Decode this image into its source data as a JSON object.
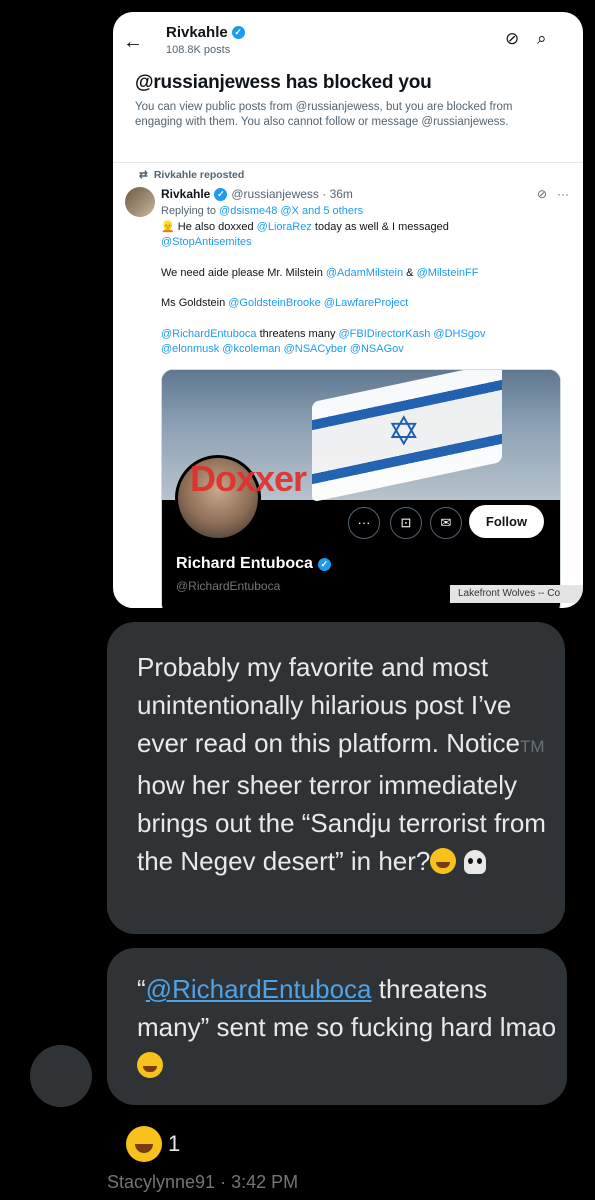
{
  "screenshot": {
    "header": {
      "back_icon": "arrow-left-icon",
      "name": "Rivkahle",
      "posts": "108.8K posts",
      "icons": [
        "grok-icon",
        "search-icon"
      ]
    },
    "blocked": {
      "title": "@russianjewess has blocked you",
      "description": "You can view public posts from @russianjewess, but you are blocked from engaging with them. You also cannot follow or message @russianjewess."
    },
    "post": {
      "repost_label": "Rivkahle reposted",
      "author_name": "Rivkahle",
      "author_meta": "@russianjewess · 36m",
      "replying_prefix": "Replying to",
      "replying_mentions": "@dsisme48 @X and 5 others",
      "line1_prefix": "He also doxxed",
      "line1_mention": "@LioraRez",
      "line1_suffix": "today as well & I messaged",
      "line1_mention2": "@StopAntisemites",
      "line2_prefix": "We need aide please Mr. Milstein",
      "line2_mention": "@AdamMilstein",
      "line2_amp": "&",
      "line2_mention2": "@MilsteinFF",
      "line3_prefix": "Ms Goldstein",
      "line3_mentions": "@GoldsteinBrooke @LawfareProject",
      "line4_mention": "@RichardEntuboca",
      "line4_text": "threatens many",
      "line4_mentions": "@FBIDirectorKash @DHSgov",
      "line5_mentions": "@elonmusk @kcoleman @NSACyber @NSAGov"
    },
    "embed": {
      "overlay_text": "Doxxer",
      "more_label": "···",
      "follow_label": "Follow",
      "profile_name": "Richard Entuboca",
      "profile_handle": "@RichardEntuboca",
      "corner_label": "Lakefront Wolves -- Co"
    }
  },
  "messages": [
    {
      "text_a": "Probably my favorite and most unintentionally hilarious post I’ve ever read on this platform. Notice",
      "tm": "TM",
      "text_b": " how her sheer terror immediately brings out the “Sandju terrorist from the Negev desert” in her?"
    },
    {
      "quote_open": "“",
      "link": "@RichardEntuboca",
      "text": " threatens many” sent me so fucking hard lmao"
    }
  ],
  "reaction": {
    "count": "1",
    "icon": "laughing-emoji-icon"
  },
  "footer": {
    "author": "Stacylynne91",
    "time": "3:42 PM"
  }
}
